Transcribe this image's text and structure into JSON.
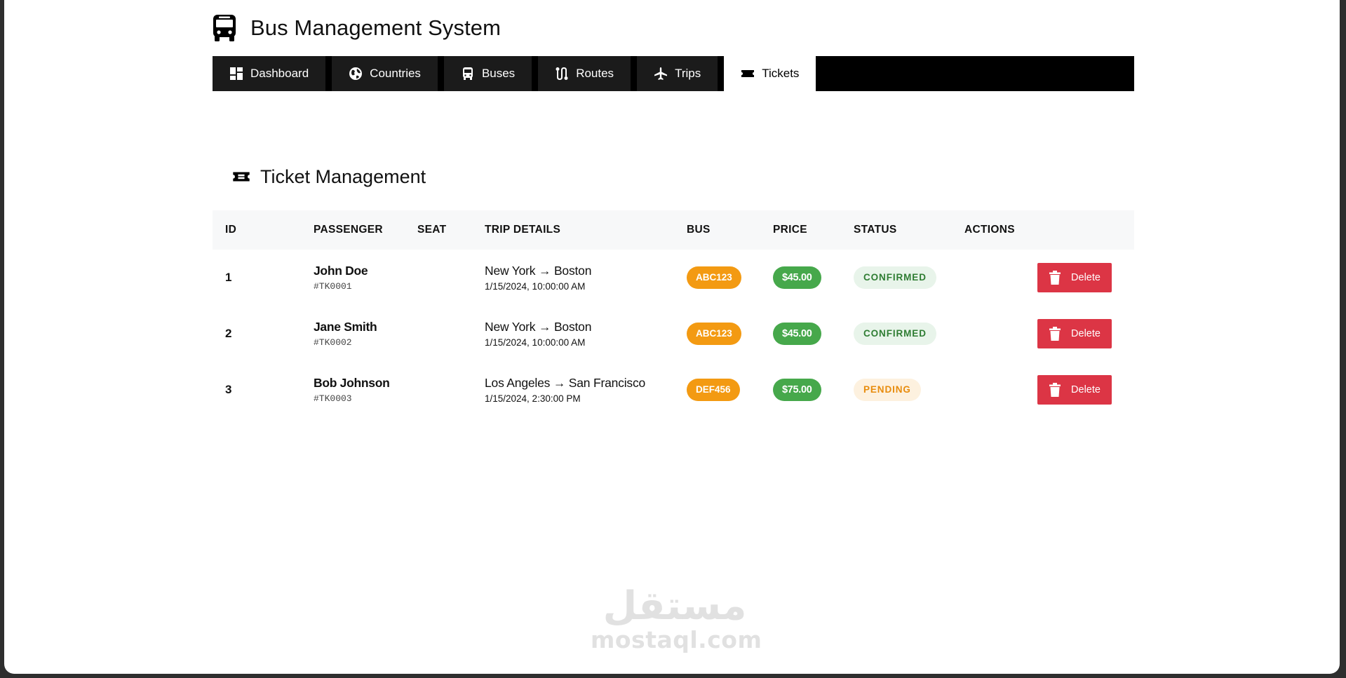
{
  "app": {
    "title": "Bus Management System"
  },
  "nav": {
    "items": [
      {
        "label": "Dashboard",
        "icon": "dashboard-icon"
      },
      {
        "label": "Countries",
        "icon": "globe-icon"
      },
      {
        "label": "Buses",
        "icon": "bus-icon"
      },
      {
        "label": "Routes",
        "icon": "route-icon"
      },
      {
        "label": "Trips",
        "icon": "airplane-icon"
      },
      {
        "label": "Tickets",
        "icon": "ticket-icon",
        "active": true
      }
    ]
  },
  "section": {
    "title": "Ticket Management"
  },
  "table": {
    "headers": {
      "id": "ID",
      "passenger": "PASSENGER",
      "seat": "SEAT",
      "trip": "TRIP DETAILS",
      "bus": "BUS",
      "price": "PRICE",
      "status": "STATUS",
      "actions": "ACTIONS"
    },
    "rows": [
      {
        "id": "1",
        "passenger": "John Doe",
        "code": "#TK0001",
        "seat": "",
        "route": "New York → Boston",
        "datetime": "1/15/2024, 10:00:00 AM",
        "bus": "ABC123",
        "price": "$45.00",
        "status": "CONFIRMED",
        "action": "Delete"
      },
      {
        "id": "2",
        "passenger": "Jane Smith",
        "code": "#TK0002",
        "seat": "",
        "route": "New York → Boston",
        "datetime": "1/15/2024, 10:00:00 AM",
        "bus": "ABC123",
        "price": "$45.00",
        "status": "CONFIRMED",
        "action": "Delete"
      },
      {
        "id": "3",
        "passenger": "Bob Johnson",
        "code": "#TK0003",
        "seat": "",
        "route": "Los Angeles → San Francisco",
        "datetime": "1/15/2024, 2:30:00 PM",
        "bus": "DEF456",
        "price": "$75.00",
        "status": "PENDING",
        "action": "Delete"
      }
    ]
  },
  "colors": {
    "nav_background": "#000000",
    "nav_item": "#1b1b1b",
    "bus_badge": "#f39a12",
    "price_badge": "#46a84b",
    "confirmed_bg": "#e8f4ea",
    "confirmed_text": "#2f7d33",
    "pending_bg": "#fdf1df",
    "pending_text": "#e88c0c",
    "delete_button": "#dc3545"
  },
  "watermark": {
    "arabic": "مستقل",
    "latin": "mostaql.com"
  }
}
